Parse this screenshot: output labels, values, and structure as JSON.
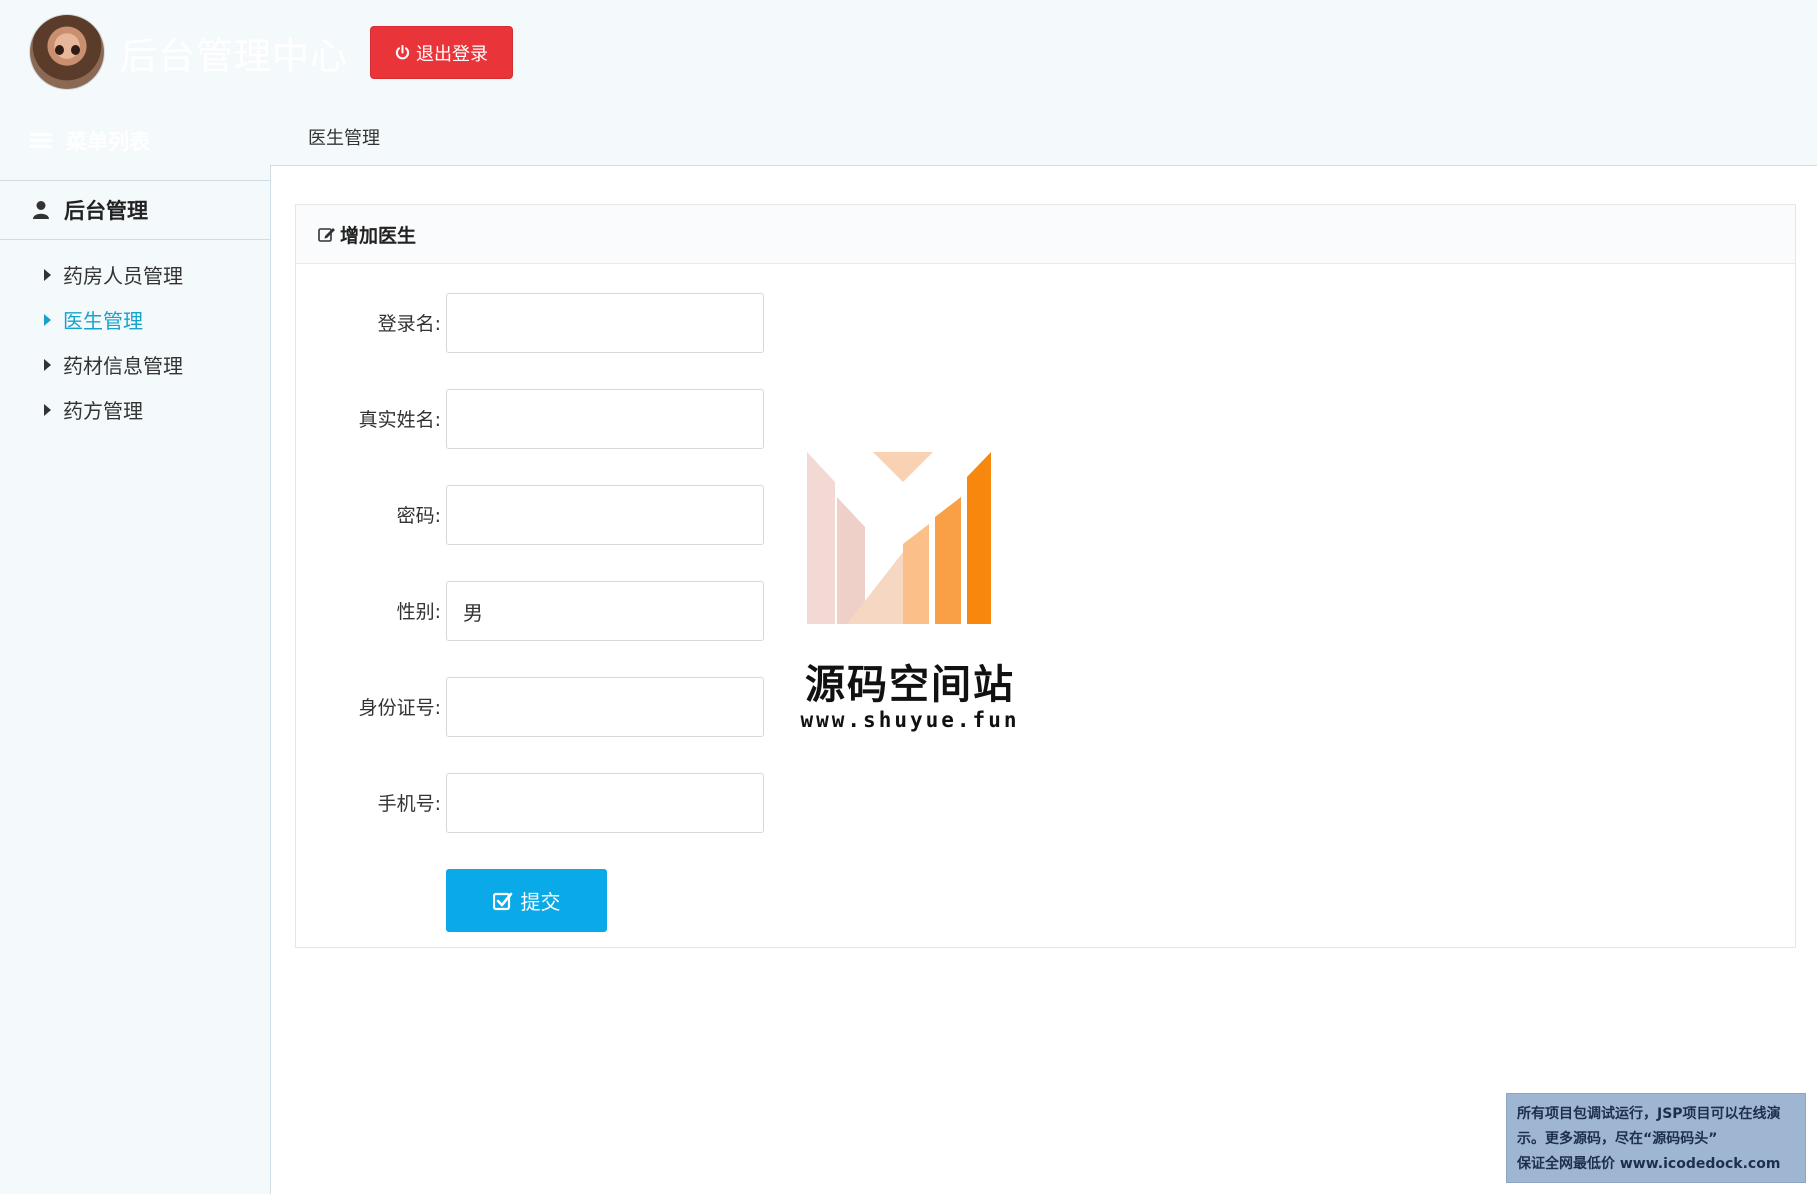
{
  "header": {
    "title": "后台管理中心",
    "logout_label": "退出登录"
  },
  "menu": {
    "heading": "菜单列表",
    "group": "后台管理",
    "items": [
      {
        "label": "药房人员管理",
        "active": false
      },
      {
        "label": "医生管理",
        "active": true
      },
      {
        "label": "药材信息管理",
        "active": false
      },
      {
        "label": "药方管理",
        "active": false
      }
    ]
  },
  "breadcrumb": "医生管理",
  "panel": {
    "title": "增加医生",
    "fields": [
      {
        "label": "登录名:",
        "value": ""
      },
      {
        "label": "真实姓名:",
        "value": ""
      },
      {
        "label": "密码:",
        "value": ""
      },
      {
        "label": "性别:",
        "value": "男"
      },
      {
        "label": "身份证号:",
        "value": ""
      },
      {
        "label": "手机号:",
        "value": ""
      }
    ],
    "submit_label": "提交"
  },
  "watermark": {
    "name": "源码空间站",
    "url": "www.shuyue.fun"
  },
  "notice": {
    "line1": "所有项目包调试运行，JSP项目可以在线演",
    "line2": "示。更多源码，尽在“源码码头”",
    "line3": "保证全网最低价 www.icodedock.com"
  },
  "colors": {
    "accent": "#16a3c9",
    "logout": "#e9353a",
    "submit": "#0aa9e8",
    "background": "#f4f9fc"
  }
}
